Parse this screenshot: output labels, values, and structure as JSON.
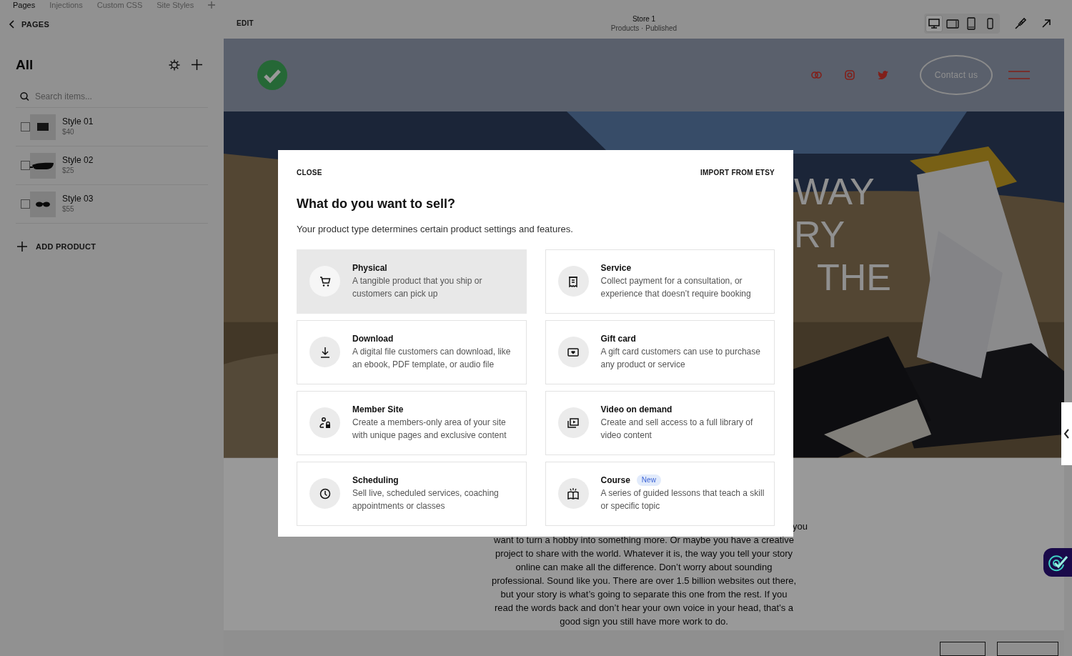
{
  "top_tabs": [
    {
      "label": "Pages",
      "selected": true
    },
    {
      "label": "Injections",
      "selected": false
    },
    {
      "label": "Custom CSS",
      "selected": false
    },
    {
      "label": "Site Styles",
      "selected": false
    }
  ],
  "sidebar": {
    "back_label": "PAGES",
    "heading": "All",
    "search": {
      "placeholder": "Search items..."
    },
    "products": [
      {
        "name": "Style 01",
        "price": "$40",
        "checked": false,
        "kind": "wallet"
      },
      {
        "name": "Style 02",
        "price": "$25",
        "checked": false,
        "kind": "bag"
      },
      {
        "name": "Style 03",
        "price": "$55",
        "checked": false,
        "kind": "glasses"
      }
    ],
    "add_label": "ADD PRODUCT"
  },
  "toolbar": {
    "edit_label": "EDIT",
    "title": "Store 1",
    "subtitle": "Products · Published",
    "devices": [
      {
        "kind": "desktop",
        "selected": true
      },
      {
        "kind": "tablet-landscape",
        "selected": false
      },
      {
        "kind": "tablet",
        "selected": false
      },
      {
        "kind": "phone",
        "selected": false
      }
    ]
  },
  "site": {
    "contact_button": "Contact us",
    "hero_lines": [
      "WAY",
      "RY",
      "THE"
    ],
    "body_fragment": "you",
    "body_lines": [
      "want to turn a hobby into something more. Or maybe you have a creative",
      "project to share with the world. Whatever it is, the way you tell your story",
      "online can make all the difference. Don’t worry about sounding",
      "professional. Sound like you. There are over 1.5 billion websites out there,",
      "but your story is what’s going to separate this one from the rest. If you",
      "read the words back and don’t hear your own voice in your head, that’s a",
      "good sign you still have more work to do."
    ]
  },
  "modal": {
    "close_label": "CLOSE",
    "import_label": "IMPORT FROM ETSY",
    "title": "What do you want to sell?",
    "subtitle": "Your product type determines certain product settings and features.",
    "options": [
      {
        "kind": "cart",
        "title": "Physical",
        "description": "A tangible product that you ship or customers can pick up",
        "selected": true
      },
      {
        "kind": "receipt",
        "title": "Service",
        "description": "Collect payment for a consultation, or experience that doesn’t require booking",
        "selected": false
      },
      {
        "kind": "download",
        "title": "Download",
        "description": "A digital file customers can download, like an ebook, PDF template, or audio file",
        "selected": false
      },
      {
        "kind": "gift",
        "title": "Gift card",
        "description": "A gift card customers can use to purchase any product or service",
        "selected": false
      },
      {
        "kind": "member",
        "title": "Member Site",
        "description": "Create a members-only area of your site with unique pages and exclusive content",
        "selected": false
      },
      {
        "kind": "video",
        "title": "Video on demand",
        "description": "Create and sell access to a full library of video content",
        "selected": false
      },
      {
        "kind": "clock",
        "title": "Scheduling",
        "description": "Sell live, scheduled services, coaching appointments or classes",
        "selected": false
      },
      {
        "kind": "book",
        "title": "Course",
        "badge": "New",
        "description": "A series of guided lessons that teach a skill or specific topic",
        "selected": false
      }
    ]
  }
}
